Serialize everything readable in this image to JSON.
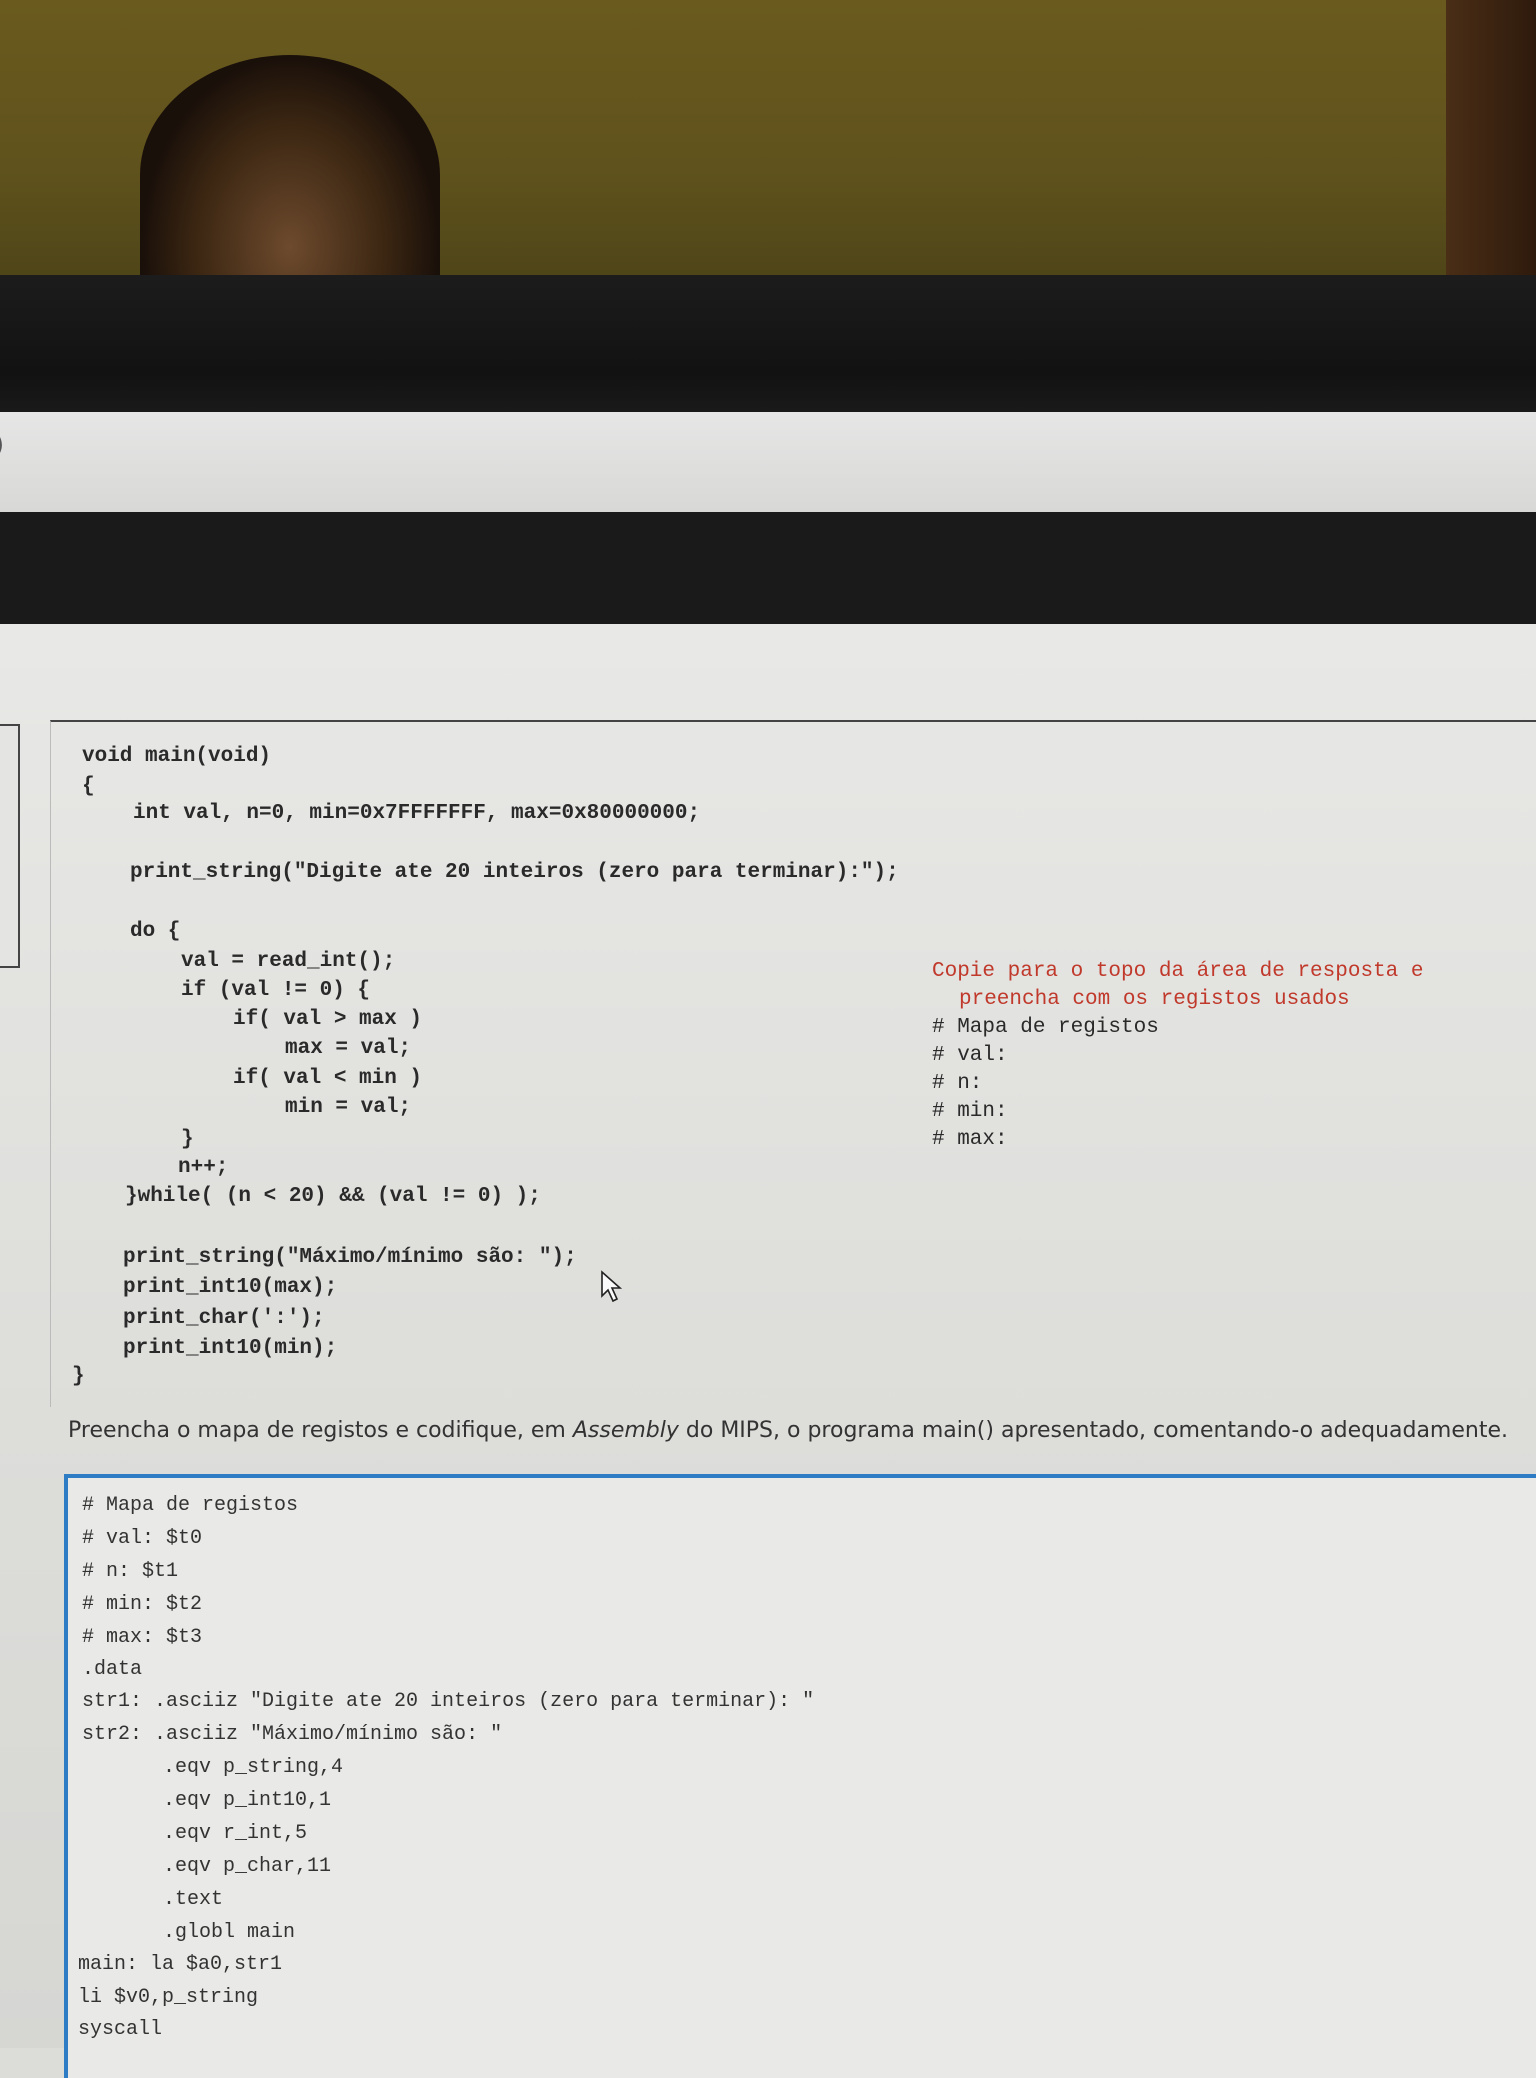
{
  "code_c": {
    "lines": [
      "void main(void)",
      "{",
      "int val, n=0, min=0x7FFFFFFF, max=0x80000000;",
      "print_string(\"Digite ate 20 inteiros (zero para terminar):\");",
      "do {",
      "val = read_int();",
      "if (val != 0) {",
      "if( val > max )",
      "max = val;",
      "if( val < min )",
      "min = val;",
      "}",
      "n++;",
      "}while( (n < 20) && (val != 0) );",
      "print_string(\"Máximo/mínimo são: \");",
      "print_int10(max);",
      "print_char(':');",
      "print_int10(min);",
      "}"
    ]
  },
  "note": {
    "instruction_line1": "Copie para o topo da área de resposta e",
    "instruction_line2": "preencha com os registos usados",
    "map_lines": [
      "# Mapa de registos",
      "# val:",
      "# n:",
      "# min:",
      "# max:"
    ]
  },
  "question": {
    "text_before": "Preencha o mapa de registos e codifique, em ",
    "text_italic": "Assembly",
    "text_after": " do MIPS, o  programa main() apresentado, comentando-o adequadamente."
  },
  "answer": {
    "lines": [
      "# Mapa de registos",
      "# val: $t0",
      "# n: $t1",
      "# min: $t2",
      "# max: $t3",
      ".data",
      "str1: .asciiz \"Digite ate 20 inteiros (zero para terminar): \"",
      "str2: .asciiz \"Máximo/mínimo são: \"",
      ".eqv p_string,4",
      ".eqv p_int10,1",
      ".eqv r_int,5",
      ".eqv p_char,11",
      ".text",
      ".globl main",
      "main: la $a0,str1",
      "li $v0,p_string",
      "syscall"
    ]
  },
  "misc": {
    "strip_glyph": ")"
  },
  "colors": {
    "accent_border": "#2e7cc4",
    "note_text": "#c0392b"
  }
}
